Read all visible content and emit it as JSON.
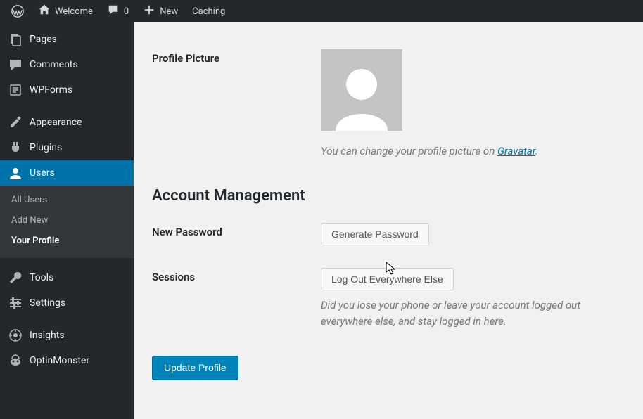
{
  "adminbar": {
    "site_title": "Welcome",
    "comments_count": "0",
    "new_label": "New",
    "caching_label": "Caching"
  },
  "sidebar": {
    "items": [
      {
        "icon": "pages",
        "label": "Pages"
      },
      {
        "icon": "comments",
        "label": "Comments"
      },
      {
        "icon": "wpforms",
        "label": "WPForms"
      },
      {
        "icon": "appearance",
        "label": "Appearance",
        "sep": true
      },
      {
        "icon": "plugins",
        "label": "Plugins"
      },
      {
        "icon": "users",
        "label": "Users",
        "current": true
      },
      {
        "icon": "tools",
        "label": "Tools",
        "sep": true
      },
      {
        "icon": "settings",
        "label": "Settings"
      },
      {
        "icon": "insights",
        "label": "Insights",
        "sep": true
      },
      {
        "icon": "optin",
        "label": "OptinMonster"
      }
    ],
    "submenu": [
      {
        "label": "All Users"
      },
      {
        "label": "Add New"
      },
      {
        "label": "Your Profile",
        "current": true
      }
    ]
  },
  "profile": {
    "picture_row_label": "Profile Picture",
    "gravatar_pre": "You can change your profile picture on ",
    "gravatar_link": "Gravatar",
    "gravatar_post": ".",
    "section_account": "Account Management",
    "newpass_row_label": "New Password",
    "generate_btn": "Generate Password",
    "sessions_row_label": "Sessions",
    "logout_btn": "Log Out Everywhere Else",
    "sessions_desc": "Did you lose your phone or leave your account logged out everywhere else, and stay logged in here.",
    "submit_btn": "Update Profile"
  }
}
